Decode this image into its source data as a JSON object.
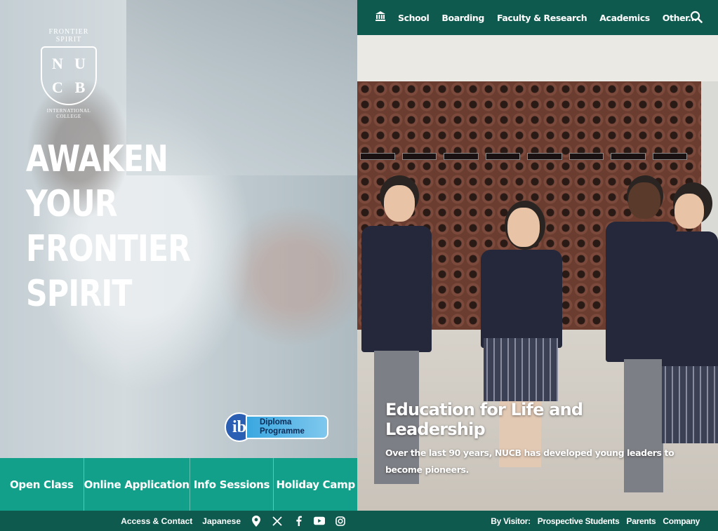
{
  "brand": {
    "crest_top": "FRONTIER SPIRIT",
    "crest_letters": [
      "N",
      "U",
      "C",
      "B"
    ],
    "crest_bottom": "INTERNATIONAL COLLEGE"
  },
  "hero": {
    "headline": [
      "AWAKEN",
      "YOUR",
      "FRONTIER",
      "SPIRIT"
    ],
    "ib_badge": {
      "logo": "ib",
      "line1": "Diploma",
      "line2": "Programme"
    }
  },
  "cta": [
    "Open Class",
    "Online Application",
    "Info Sessions",
    "Holiday Camp"
  ],
  "left_footer": {
    "access": "Access & Contact",
    "language": "Japanese",
    "icons": [
      "location-icon",
      "x-icon",
      "facebook-icon",
      "youtube-icon",
      "instagram-icon"
    ]
  },
  "topnav": {
    "home_icon": "school-building-icon",
    "items": [
      "School",
      "Boarding",
      "Faculty & Research",
      "Academics",
      "Other..."
    ],
    "search_icon": "search-icon"
  },
  "feature": {
    "title": "Education for Life and Leadership",
    "text": "Over the last 90 years, NUCB has developed young leaders to become pioneers."
  },
  "right_footer": {
    "label": "By Visitor:",
    "links": [
      "Prospective Students",
      "Parents",
      "Company"
    ]
  },
  "colors": {
    "teal": "#12a08a",
    "dark_green": "#0f5a4e",
    "ib_blue": "#2b5fb3"
  }
}
